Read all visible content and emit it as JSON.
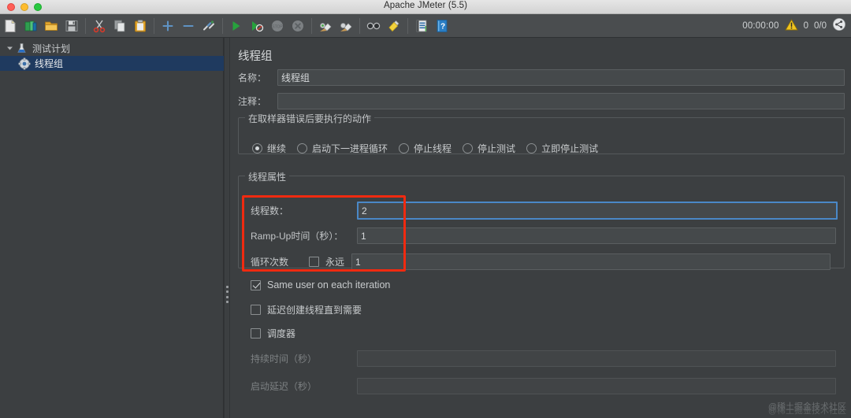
{
  "window": {
    "title": "Apache JMeter (5.5)",
    "traffic_lights": [
      "close-red",
      "minimize-yellow",
      "maximize-green"
    ]
  },
  "toolbar": {
    "groups": [
      [
        {
          "name": "new-icon",
          "label": "New"
        },
        {
          "name": "templates-icon",
          "label": "Templates"
        },
        {
          "name": "open-icon",
          "label": "Open"
        },
        {
          "name": "save-icon",
          "label": "Save"
        }
      ],
      [
        {
          "name": "cut-icon",
          "label": "Cut"
        },
        {
          "name": "copy-icon",
          "label": "Copy"
        },
        {
          "name": "paste-icon",
          "label": "Paste"
        }
      ],
      [
        {
          "name": "expand-all-icon",
          "label": "Expand All"
        },
        {
          "name": "collapse-all-icon",
          "label": "Collapse All"
        },
        {
          "name": "toggle-icon",
          "label": "Toggle"
        }
      ],
      [
        {
          "name": "start-icon",
          "label": "Start"
        },
        {
          "name": "start-no-pauses-icon",
          "label": "Start no pauses"
        },
        {
          "name": "stop-icon",
          "label": "Stop"
        },
        {
          "name": "shutdown-icon",
          "label": "Shutdown"
        }
      ],
      [
        {
          "name": "clear-icon",
          "label": "Clear"
        },
        {
          "name": "clear-all-icon",
          "label": "Clear All"
        }
      ],
      [
        {
          "name": "search-icon",
          "label": "Search"
        },
        {
          "name": "reset-search-icon",
          "label": "Reset Search"
        }
      ],
      [
        {
          "name": "function-helper-icon",
          "label": "Function Helper Dialog"
        },
        {
          "name": "help-icon",
          "label": "Help"
        }
      ]
    ],
    "status": {
      "elapsed": "00:00:00",
      "warning_icon": "warning-triangle-icon",
      "warning_count": "0",
      "threads": "0/0",
      "connection_icon": "connection-indicator-icon"
    }
  },
  "tree": {
    "items": [
      {
        "label": "测试计划",
        "icon": "test-plan-icon",
        "depth": 0,
        "expanded": true,
        "selected": false
      },
      {
        "label": "线程组",
        "icon": "thread-group-icon",
        "depth": 1,
        "expanded": false,
        "selected": true
      }
    ]
  },
  "main": {
    "panel_title": "线程组",
    "name_label": "名称：",
    "name_value": "线程组",
    "comment_label": "注释：",
    "comment_value": "",
    "on_error": {
      "group_title": "在取样器错误后要执行的动作",
      "options": [
        {
          "label": "继续",
          "checked": true
        },
        {
          "label": "启动下一进程循环",
          "checked": false
        },
        {
          "label": "停止线程",
          "checked": false
        },
        {
          "label": "停止测试",
          "checked": false
        },
        {
          "label": "立即停止测试",
          "checked": false
        }
      ]
    },
    "thread_props": {
      "group_title": "线程属性",
      "threads_label": "线程数：",
      "threads_value": "2",
      "rampup_label": "Ramp-Up时间（秒）：",
      "rampup_value": "1",
      "loops_label": "循环次数",
      "forever_label": "永远",
      "forever_checked": false,
      "loops_value": "1"
    },
    "checkboxes": [
      {
        "label": "Same user on each iteration",
        "checked": true,
        "disabled": false,
        "name": "same-user-each-iteration"
      },
      {
        "label": "延迟创建线程直到需要",
        "checked": false,
        "disabled": false,
        "name": "delay-thread-creation"
      },
      {
        "label": "调度器",
        "checked": false,
        "disabled": false,
        "name": "scheduler"
      }
    ],
    "scheduler": {
      "duration_label": "持续时间（秒）",
      "duration_value": "",
      "startup_delay_label": "启动延迟（秒）",
      "startup_delay_value": ""
    }
  },
  "annotation": {
    "color": "#f02a10",
    "shape": "rectangle-highlight"
  },
  "watermark": {
    "line1": "@稀土掘金技术社区",
    "line2": "@稀土掘金技术社区"
  }
}
